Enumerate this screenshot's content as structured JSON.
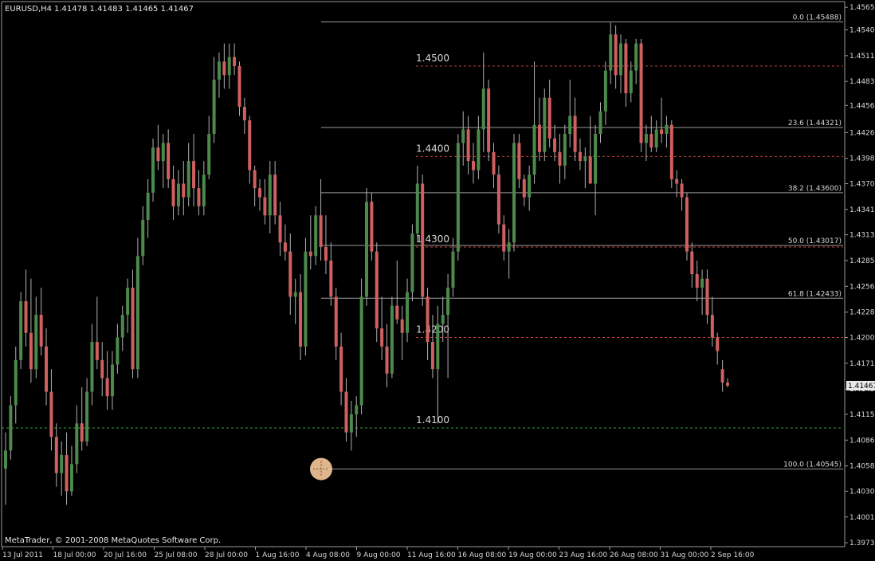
{
  "header": {
    "symbol": "EURUSD,H4",
    "ohlc": "1.41478 1.41483 1.41465 1.41467"
  },
  "footer": {
    "copyright": "MetaTrader, © 2001-2008 MetaQuotes Software Corp."
  },
  "colors": {
    "background": "#000000",
    "bull_candle": "#4c8a4c",
    "bear_candle": "#d06060",
    "fibo_line": "#9a9a9a",
    "level_line_red": "#c84040",
    "level_line_green": "#3aa03a",
    "text": "#d8d8d8",
    "price_tag_bg": "#e8e8e8",
    "marker": "#f7c99a"
  },
  "chart_data": {
    "type": "candlestick",
    "symbol": "EURUSD",
    "timeframe": "H4",
    "ylim": [
      1.3974,
      1.4566
    ],
    "y_ticks": [
      "1.45650",
      "1.45400",
      "1.45115",
      "1.44830",
      "1.44565",
      "1.44265",
      "1.43980",
      "1.43700",
      "1.43415",
      "1.43135",
      "1.42850",
      "1.42565",
      "1.42280",
      "1.42000",
      "1.41715",
      "1.41430",
      "1.41150",
      "1.40865",
      "1.40580",
      "1.40300",
      "1.40015",
      "1.39730"
    ],
    "x_ticks": [
      "13 Jul 2011",
      "18 Jul 00:00",
      "20 Jul 16:00",
      "25 Jul 08:00",
      "28 Jul 00:00",
      "1 Aug 16:00",
      "4 Aug 08:00",
      "9 Aug 00:00",
      "11 Aug 16:00",
      "16 Aug 08:00",
      "19 Aug 00:00",
      "23 Aug 16:00",
      "26 Aug 08:00",
      "31 Aug 00:00",
      "2 Sep 16:00"
    ],
    "current_price": "1.41467",
    "current_price_value": 1.41467,
    "horizontal_levels": [
      {
        "price": 1.45,
        "label": "1.4500",
        "style": "red-dashed"
      },
      {
        "price": 1.44,
        "label": "1.4400",
        "style": "red-dashed"
      },
      {
        "price": 1.43,
        "label": "1.4300",
        "style": "red-dashed"
      },
      {
        "price": 1.42,
        "label": "1.4200",
        "style": "red-dashed"
      },
      {
        "price": 1.41,
        "label": "1.4100",
        "style": "green-dashed"
      }
    ],
    "fibonacci_levels": [
      {
        "label": "0.0 (1.45488)",
        "price": 1.45488
      },
      {
        "label": "23.6 (1.44321)",
        "price": 1.44321
      },
      {
        "label": "38.2 (1.43600)",
        "price": 1.436
      },
      {
        "label": "50.0 (1.43017)",
        "price": 1.43017
      },
      {
        "label": "61.8 (1.42433)",
        "price": 1.42433
      },
      {
        "label": "100.0 (1.40545)",
        "price": 1.40545
      }
    ],
    "fibo_anchor_price": 1.40545,
    "candles": [
      {
        "o": 1.4055,
        "h": 1.4095,
        "l": 1.4015,
        "c": 1.4075
      },
      {
        "o": 1.4075,
        "h": 1.4135,
        "l": 1.4065,
        "c": 1.4125
      },
      {
        "o": 1.4125,
        "h": 1.419,
        "l": 1.4105,
        "c": 1.4175
      },
      {
        "o": 1.4175,
        "h": 1.425,
        "l": 1.4165,
        "c": 1.424
      },
      {
        "o": 1.424,
        "h": 1.4275,
        "l": 1.419,
        "c": 1.4205
      },
      {
        "o": 1.4205,
        "h": 1.4265,
        "l": 1.415,
        "c": 1.4165
      },
      {
        "o": 1.4165,
        "h": 1.4245,
        "l": 1.4155,
        "c": 1.4225
      },
      {
        "o": 1.4225,
        "h": 1.4255,
        "l": 1.418,
        "c": 1.419
      },
      {
        "o": 1.419,
        "h": 1.421,
        "l": 1.4125,
        "c": 1.414
      },
      {
        "o": 1.414,
        "h": 1.4165,
        "l": 1.4075,
        "c": 1.409
      },
      {
        "o": 1.409,
        "h": 1.4105,
        "l": 1.4035,
        "c": 1.405
      },
      {
        "o": 1.405,
        "h": 1.4085,
        "l": 1.4025,
        "c": 1.407
      },
      {
        "o": 1.407,
        "h": 1.4095,
        "l": 1.4015,
        "c": 1.403
      },
      {
        "o": 1.403,
        "h": 1.408,
        "l": 1.4025,
        "c": 1.406
      },
      {
        "o": 1.406,
        "h": 1.4125,
        "l": 1.405,
        "c": 1.4105
      },
      {
        "o": 1.4105,
        "h": 1.4145,
        "l": 1.4075,
        "c": 1.4085
      },
      {
        "o": 1.4085,
        "h": 1.4155,
        "l": 1.408,
        "c": 1.414
      },
      {
        "o": 1.414,
        "h": 1.4215,
        "l": 1.4125,
        "c": 1.4195
      },
      {
        "o": 1.4195,
        "h": 1.4245,
        "l": 1.4165,
        "c": 1.4175
      },
      {
        "o": 1.4175,
        "h": 1.4195,
        "l": 1.4135,
        "c": 1.4155
      },
      {
        "o": 1.4155,
        "h": 1.4185,
        "l": 1.412,
        "c": 1.4135
      },
      {
        "o": 1.4135,
        "h": 1.4185,
        "l": 1.412,
        "c": 1.417
      },
      {
        "o": 1.417,
        "h": 1.4215,
        "l": 1.416,
        "c": 1.42
      },
      {
        "o": 1.42,
        "h": 1.4235,
        "l": 1.4185,
        "c": 1.4225
      },
      {
        "o": 1.4225,
        "h": 1.4265,
        "l": 1.4205,
        "c": 1.4255
      },
      {
        "o": 1.4255,
        "h": 1.4275,
        "l": 1.4155,
        "c": 1.4165
      },
      {
        "o": 1.4165,
        "h": 1.431,
        "l": 1.4155,
        "c": 1.429
      },
      {
        "o": 1.429,
        "h": 1.4345,
        "l": 1.428,
        "c": 1.433
      },
      {
        "o": 1.433,
        "h": 1.4375,
        "l": 1.431,
        "c": 1.436
      },
      {
        "o": 1.436,
        "h": 1.442,
        "l": 1.435,
        "c": 1.441
      },
      {
        "o": 1.441,
        "h": 1.4435,
        "l": 1.4385,
        "c": 1.4395
      },
      {
        "o": 1.4395,
        "h": 1.4425,
        "l": 1.4365,
        "c": 1.4415
      },
      {
        "o": 1.4415,
        "h": 1.443,
        "l": 1.4365,
        "c": 1.4375
      },
      {
        "o": 1.4375,
        "h": 1.439,
        "l": 1.433,
        "c": 1.4345
      },
      {
        "o": 1.4345,
        "h": 1.4385,
        "l": 1.4335,
        "c": 1.437
      },
      {
        "o": 1.437,
        "h": 1.4395,
        "l": 1.4335,
        "c": 1.4355
      },
      {
        "o": 1.4355,
        "h": 1.4415,
        "l": 1.4345,
        "c": 1.4395
      },
      {
        "o": 1.4395,
        "h": 1.4425,
        "l": 1.4345,
        "c": 1.4365
      },
      {
        "o": 1.4365,
        "h": 1.4385,
        "l": 1.4335,
        "c": 1.4345
      },
      {
        "o": 1.4345,
        "h": 1.4395,
        "l": 1.4335,
        "c": 1.438
      },
      {
        "o": 1.438,
        "h": 1.4445,
        "l": 1.4375,
        "c": 1.4425
      },
      {
        "o": 1.4425,
        "h": 1.451,
        "l": 1.4415,
        "c": 1.4485
      },
      {
        "o": 1.4485,
        "h": 1.4515,
        "l": 1.4465,
        "c": 1.4505
      },
      {
        "o": 1.4505,
        "h": 1.4525,
        "l": 1.4475,
        "c": 1.449
      },
      {
        "o": 1.449,
        "h": 1.4525,
        "l": 1.4475,
        "c": 1.451
      },
      {
        "o": 1.451,
        "h": 1.4525,
        "l": 1.449,
        "c": 1.45
      },
      {
        "o": 1.45,
        "h": 1.4505,
        "l": 1.4445,
        "c": 1.4455
      },
      {
        "o": 1.4455,
        "h": 1.4465,
        "l": 1.4425,
        "c": 1.444
      },
      {
        "o": 1.444,
        "h": 1.4445,
        "l": 1.437,
        "c": 1.4385
      },
      {
        "o": 1.4385,
        "h": 1.439,
        "l": 1.4345,
        "c": 1.4365
      },
      {
        "o": 1.4365,
        "h": 1.4375,
        "l": 1.434,
        "c": 1.4355
      },
      {
        "o": 1.4355,
        "h": 1.4375,
        "l": 1.4325,
        "c": 1.4335
      },
      {
        "o": 1.4335,
        "h": 1.4395,
        "l": 1.4315,
        "c": 1.438
      },
      {
        "o": 1.438,
        "h": 1.4395,
        "l": 1.4325,
        "c": 1.4335
      },
      {
        "o": 1.4335,
        "h": 1.435,
        "l": 1.429,
        "c": 1.4305
      },
      {
        "o": 1.4305,
        "h": 1.4325,
        "l": 1.4285,
        "c": 1.4295
      },
      {
        "o": 1.4295,
        "h": 1.4315,
        "l": 1.4225,
        "c": 1.4245
      },
      {
        "o": 1.4245,
        "h": 1.4265,
        "l": 1.4215,
        "c": 1.425
      },
      {
        "o": 1.425,
        "h": 1.427,
        "l": 1.4175,
        "c": 1.419
      },
      {
        "o": 1.419,
        "h": 1.431,
        "l": 1.418,
        "c": 1.4295
      },
      {
        "o": 1.4295,
        "h": 1.4335,
        "l": 1.4275,
        "c": 1.429
      },
      {
        "o": 1.429,
        "h": 1.4345,
        "l": 1.428,
        "c": 1.4335
      },
      {
        "o": 1.4335,
        "h": 1.4375,
        "l": 1.4285,
        "c": 1.43
      },
      {
        "o": 1.43,
        "h": 1.4335,
        "l": 1.427,
        "c": 1.4285
      },
      {
        "o": 1.4285,
        "h": 1.4305,
        "l": 1.4235,
        "c": 1.4245
      },
      {
        "o": 1.4245,
        "h": 1.4255,
        "l": 1.4175,
        "c": 1.419
      },
      {
        "o": 1.419,
        "h": 1.4205,
        "l": 1.4125,
        "c": 1.414
      },
      {
        "o": 1.414,
        "h": 1.4155,
        "l": 1.4085,
        "c": 1.4095
      },
      {
        "o": 1.4095,
        "h": 1.413,
        "l": 1.4075,
        "c": 1.4115
      },
      {
        "o": 1.4115,
        "h": 1.4135,
        "l": 1.409,
        "c": 1.4125
      },
      {
        "o": 1.4125,
        "h": 1.4265,
        "l": 1.4115,
        "c": 1.4245
      },
      {
        "o": 1.4245,
        "h": 1.4365,
        "l": 1.4235,
        "c": 1.435
      },
      {
        "o": 1.435,
        "h": 1.436,
        "l": 1.4285,
        "c": 1.4295
      },
      {
        "o": 1.4295,
        "h": 1.4305,
        "l": 1.4195,
        "c": 1.421
      },
      {
        "o": 1.421,
        "h": 1.4245,
        "l": 1.4175,
        "c": 1.419
      },
      {
        "o": 1.419,
        "h": 1.4215,
        "l": 1.4145,
        "c": 1.416
      },
      {
        "o": 1.416,
        "h": 1.4245,
        "l": 1.4155,
        "c": 1.4235
      },
      {
        "o": 1.4235,
        "h": 1.4285,
        "l": 1.4215,
        "c": 1.422
      },
      {
        "o": 1.422,
        "h": 1.4235,
        "l": 1.4175,
        "c": 1.4205
      },
      {
        "o": 1.4205,
        "h": 1.4265,
        "l": 1.4195,
        "c": 1.425
      },
      {
        "o": 1.425,
        "h": 1.4325,
        "l": 1.424,
        "c": 1.4315
      },
      {
        "o": 1.4315,
        "h": 1.439,
        "l": 1.4305,
        "c": 1.437
      },
      {
        "o": 1.437,
        "h": 1.438,
        "l": 1.4235,
        "c": 1.4245
      },
      {
        "o": 1.4245,
        "h": 1.4255,
        "l": 1.4175,
        "c": 1.4195
      },
      {
        "o": 1.4195,
        "h": 1.4225,
        "l": 1.4155,
        "c": 1.4165
      },
      {
        "o": 1.4165,
        "h": 1.4235,
        "l": 1.4105,
        "c": 1.4215
      },
      {
        "o": 1.4215,
        "h": 1.4245,
        "l": 1.4195,
        "c": 1.4225
      },
      {
        "o": 1.4225,
        "h": 1.427,
        "l": 1.4155,
        "c": 1.4255
      },
      {
        "o": 1.4255,
        "h": 1.431,
        "l": 1.4245,
        "c": 1.4295
      },
      {
        "o": 1.4295,
        "h": 1.4425,
        "l": 1.4285,
        "c": 1.4415
      },
      {
        "o": 1.4415,
        "h": 1.445,
        "l": 1.439,
        "c": 1.443
      },
      {
        "o": 1.443,
        "h": 1.4445,
        "l": 1.438,
        "c": 1.4395
      },
      {
        "o": 1.4395,
        "h": 1.4415,
        "l": 1.437,
        "c": 1.4385
      },
      {
        "o": 1.4385,
        "h": 1.4445,
        "l": 1.4375,
        "c": 1.443
      },
      {
        "o": 1.443,
        "h": 1.4515,
        "l": 1.4405,
        "c": 1.4475
      },
      {
        "o": 1.4475,
        "h": 1.4485,
        "l": 1.4395,
        "c": 1.4405
      },
      {
        "o": 1.4405,
        "h": 1.4415,
        "l": 1.4365,
        "c": 1.438
      },
      {
        "o": 1.438,
        "h": 1.439,
        "l": 1.4315,
        "c": 1.4325
      },
      {
        "o": 1.4325,
        "h": 1.4335,
        "l": 1.4285,
        "c": 1.4295
      },
      {
        "o": 1.4295,
        "h": 1.432,
        "l": 1.4265,
        "c": 1.4305
      },
      {
        "o": 1.4305,
        "h": 1.4425,
        "l": 1.4295,
        "c": 1.4415
      },
      {
        "o": 1.4415,
        "h": 1.4425,
        "l": 1.4365,
        "c": 1.4375
      },
      {
        "o": 1.4375,
        "h": 1.438,
        "l": 1.4345,
        "c": 1.4355
      },
      {
        "o": 1.4355,
        "h": 1.439,
        "l": 1.434,
        "c": 1.438
      },
      {
        "o": 1.438,
        "h": 1.4505,
        "l": 1.437,
        "c": 1.4435
      },
      {
        "o": 1.4435,
        "h": 1.4465,
        "l": 1.4395,
        "c": 1.4405
      },
      {
        "o": 1.4405,
        "h": 1.4475,
        "l": 1.4395,
        "c": 1.4465
      },
      {
        "o": 1.4465,
        "h": 1.4485,
        "l": 1.441,
        "c": 1.442
      },
      {
        "o": 1.442,
        "h": 1.4435,
        "l": 1.4395,
        "c": 1.4405
      },
      {
        "o": 1.4405,
        "h": 1.4425,
        "l": 1.437,
        "c": 1.439
      },
      {
        "o": 1.439,
        "h": 1.4435,
        "l": 1.4375,
        "c": 1.4425
      },
      {
        "o": 1.4425,
        "h": 1.4485,
        "l": 1.441,
        "c": 1.4445
      },
      {
        "o": 1.4445,
        "h": 1.4465,
        "l": 1.4395,
        "c": 1.4405
      },
      {
        "o": 1.4405,
        "h": 1.442,
        "l": 1.4385,
        "c": 1.4395
      },
      {
        "o": 1.4395,
        "h": 1.441,
        "l": 1.4365,
        "c": 1.44
      },
      {
        "o": 1.44,
        "h": 1.4445,
        "l": 1.4375,
        "c": 1.437
      },
      {
        "o": 1.437,
        "h": 1.4435,
        "l": 1.4335,
        "c": 1.4425
      },
      {
        "o": 1.4425,
        "h": 1.446,
        "l": 1.4415,
        "c": 1.445
      },
      {
        "o": 1.445,
        "h": 1.4505,
        "l": 1.4435,
        "c": 1.4495
      },
      {
        "o": 1.4495,
        "h": 1.4548,
        "l": 1.448,
        "c": 1.4535
      },
      {
        "o": 1.4535,
        "h": 1.4545,
        "l": 1.4475,
        "c": 1.449
      },
      {
        "o": 1.449,
        "h": 1.4535,
        "l": 1.447,
        "c": 1.4525
      },
      {
        "o": 1.4525,
        "h": 1.453,
        "l": 1.4455,
        "c": 1.447
      },
      {
        "o": 1.447,
        "h": 1.4505,
        "l": 1.446,
        "c": 1.4495
      },
      {
        "o": 1.4495,
        "h": 1.453,
        "l": 1.448,
        "c": 1.4525
      },
      {
        "o": 1.4525,
        "h": 1.453,
        "l": 1.4405,
        "c": 1.4415
      },
      {
        "o": 1.4415,
        "h": 1.4435,
        "l": 1.4395,
        "c": 1.4425
      },
      {
        "o": 1.4425,
        "h": 1.4445,
        "l": 1.4405,
        "c": 1.441
      },
      {
        "o": 1.441,
        "h": 1.444,
        "l": 1.4405,
        "c": 1.443
      },
      {
        "o": 1.443,
        "h": 1.4465,
        "l": 1.4415,
        "c": 1.4425
      },
      {
        "o": 1.4425,
        "h": 1.4445,
        "l": 1.441,
        "c": 1.4435
      },
      {
        "o": 1.4435,
        "h": 1.444,
        "l": 1.4365,
        "c": 1.4375
      },
      {
        "o": 1.4375,
        "h": 1.4385,
        "l": 1.4355,
        "c": 1.437
      },
      {
        "o": 1.437,
        "h": 1.4375,
        "l": 1.434,
        "c": 1.4355
      },
      {
        "o": 1.4355,
        "h": 1.436,
        "l": 1.4285,
        "c": 1.4295
      },
      {
        "o": 1.4295,
        "h": 1.4305,
        "l": 1.4255,
        "c": 1.427
      },
      {
        "o": 1.427,
        "h": 1.4285,
        "l": 1.424,
        "c": 1.4255
      },
      {
        "o": 1.4255,
        "h": 1.4275,
        "l": 1.4225,
        "c": 1.4265
      },
      {
        "o": 1.4265,
        "h": 1.4275,
        "l": 1.4215,
        "c": 1.4225
      },
      {
        "o": 1.4225,
        "h": 1.4245,
        "l": 1.419,
        "c": 1.42
      },
      {
        "o": 1.42,
        "h": 1.4205,
        "l": 1.417,
        "c": 1.4185
      },
      {
        "o": 1.4165,
        "h": 1.4175,
        "l": 1.414,
        "c": 1.415
      },
      {
        "o": 1.415,
        "h": 1.4155,
        "l": 1.4145,
        "c": 1.41467
      }
    ]
  }
}
